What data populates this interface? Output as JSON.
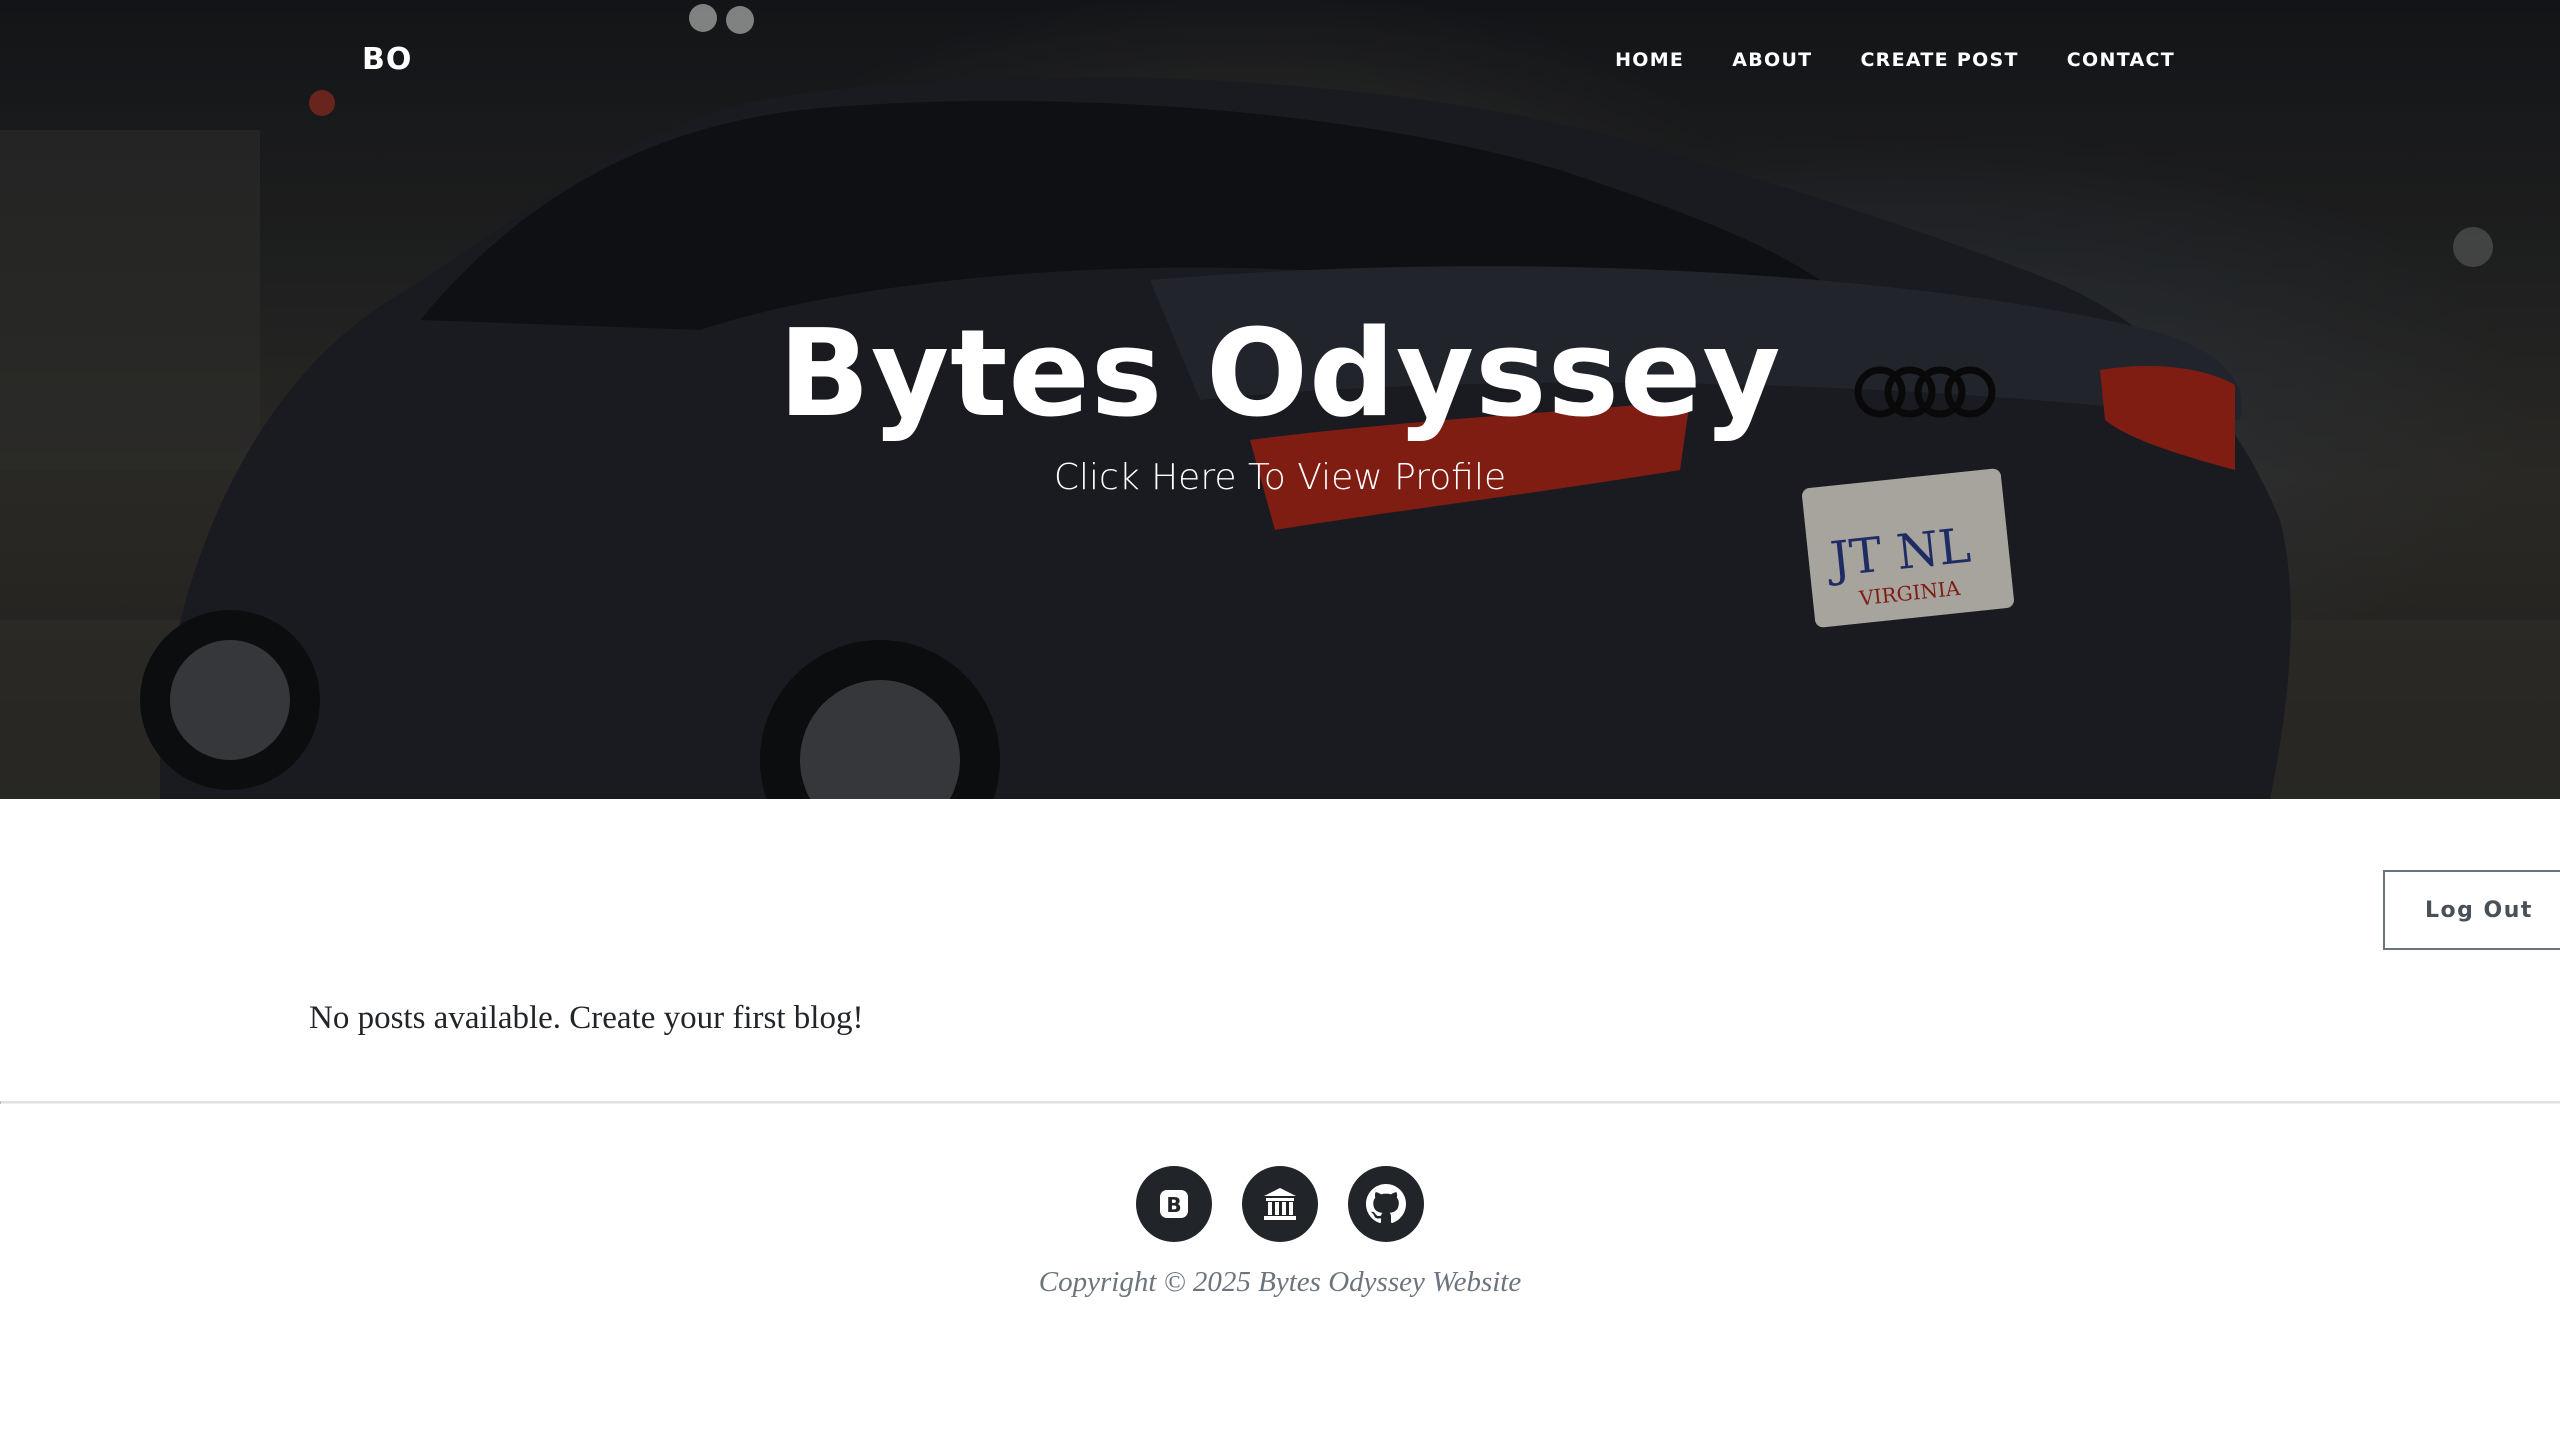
{
  "nav": {
    "brand": "BO",
    "links": [
      "HOME",
      "ABOUT",
      "CREATE POST",
      "CONTACT"
    ]
  },
  "hero": {
    "title": "Bytes Odyssey",
    "subtitle": "Click Here To View Profile",
    "plate_text": "JT NL",
    "plate_state": "VIRGINIA"
  },
  "main": {
    "logout_label": "Log Out",
    "empty_message": "No posts available. Create your first blog!"
  },
  "footer": {
    "icons": [
      "bootstrap-icon",
      "bank-icon",
      "github-icon"
    ],
    "bootstrap_letter": "B",
    "copyright": "Copyright © 2025 Bytes Odyssey Website"
  },
  "colors": {
    "footer_icon_bg": "#212529",
    "muted_text": "#6c757d",
    "body_text": "#212529"
  }
}
